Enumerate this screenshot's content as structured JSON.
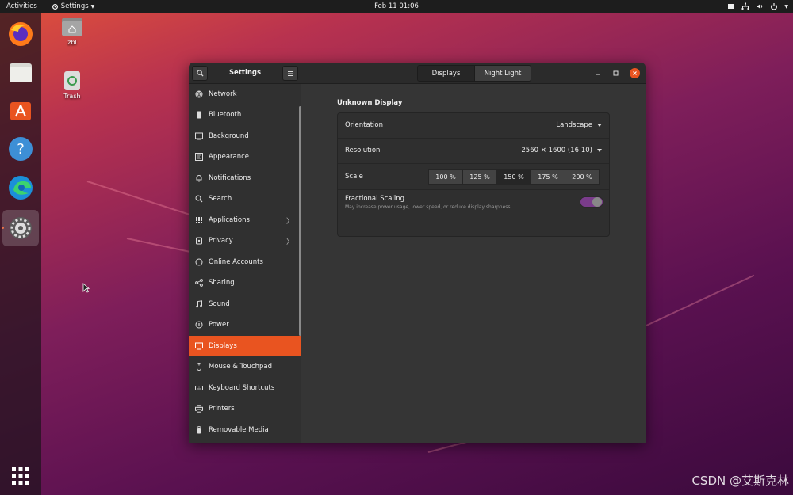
{
  "topbar": {
    "activities": "Activities",
    "app_menu": "Settings",
    "clock": "Feb 11  01:06"
  },
  "desktop": {
    "icons": [
      {
        "label": "zbl"
      },
      {
        "label": "Trash"
      }
    ]
  },
  "dock": {
    "items": [
      "Firefox",
      "Files",
      "Ubuntu Software",
      "Help",
      "Microsoft Edge",
      "Settings",
      "Show Applications"
    ]
  },
  "window": {
    "header_title": "Settings",
    "tabs": [
      {
        "label": "Displays",
        "selected": true
      },
      {
        "label": "Night Light",
        "selected": false
      }
    ]
  },
  "sidebar": {
    "items": [
      {
        "label": "Network",
        "icon": "network-icon"
      },
      {
        "label": "Bluetooth",
        "icon": "bluetooth-icon"
      },
      {
        "label": "Background",
        "icon": "background-icon"
      },
      {
        "label": "Appearance",
        "icon": "appearance-icon"
      },
      {
        "label": "Notifications",
        "icon": "bell-icon"
      },
      {
        "label": "Search",
        "icon": "search-icon"
      },
      {
        "label": "Applications",
        "icon": "grid-icon",
        "has_submenu": true
      },
      {
        "label": "Privacy",
        "icon": "privacy-icon",
        "has_submenu": true
      },
      {
        "label": "Online Accounts",
        "icon": "cloud-icon"
      },
      {
        "label": "Sharing",
        "icon": "share-icon"
      },
      {
        "label": "Sound",
        "icon": "music-note-icon"
      },
      {
        "label": "Power",
        "icon": "power-icon"
      },
      {
        "label": "Displays",
        "icon": "display-icon",
        "active": true
      },
      {
        "label": "Mouse & Touchpad",
        "icon": "mouse-icon"
      },
      {
        "label": "Keyboard Shortcuts",
        "icon": "keyboard-icon"
      },
      {
        "label": "Printers",
        "icon": "printer-icon"
      },
      {
        "label": "Removable Media",
        "icon": "usb-icon"
      }
    ]
  },
  "display": {
    "heading": "Unknown Display",
    "orientation": {
      "label": "Orientation",
      "value": "Landscape"
    },
    "resolution": {
      "label": "Resolution",
      "value": "2560 × 1600 (16:10)"
    },
    "scale": {
      "label": "Scale",
      "options": [
        "100 %",
        "125 %",
        "150 %",
        "175 %",
        "200 %"
      ],
      "selected": "150 %"
    },
    "fractional_scaling": {
      "label": "Fractional Scaling",
      "subtitle": "May increase power usage, lower speed, or reduce display sharpness.",
      "enabled": true
    }
  },
  "colors": {
    "accent": "#e95420",
    "toggle_on": "#7a3c8b"
  },
  "watermark": "CSDN @艾斯克林"
}
